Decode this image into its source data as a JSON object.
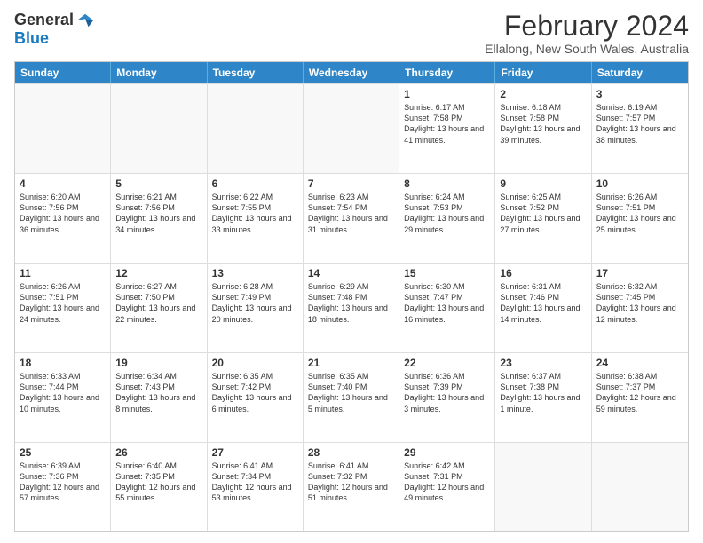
{
  "logo": {
    "general": "General",
    "blue": "Blue"
  },
  "title": "February 2024",
  "subtitle": "Ellalong, New South Wales, Australia",
  "header_days": [
    "Sunday",
    "Monday",
    "Tuesday",
    "Wednesday",
    "Thursday",
    "Friday",
    "Saturday"
  ],
  "weeks": [
    [
      {
        "day": "",
        "text": ""
      },
      {
        "day": "",
        "text": ""
      },
      {
        "day": "",
        "text": ""
      },
      {
        "day": "",
        "text": ""
      },
      {
        "day": "1",
        "text": "Sunrise: 6:17 AM\nSunset: 7:58 PM\nDaylight: 13 hours and 41 minutes."
      },
      {
        "day": "2",
        "text": "Sunrise: 6:18 AM\nSunset: 7:58 PM\nDaylight: 13 hours and 39 minutes."
      },
      {
        "day": "3",
        "text": "Sunrise: 6:19 AM\nSunset: 7:57 PM\nDaylight: 13 hours and 38 minutes."
      }
    ],
    [
      {
        "day": "4",
        "text": "Sunrise: 6:20 AM\nSunset: 7:56 PM\nDaylight: 13 hours and 36 minutes."
      },
      {
        "day": "5",
        "text": "Sunrise: 6:21 AM\nSunset: 7:56 PM\nDaylight: 13 hours and 34 minutes."
      },
      {
        "day": "6",
        "text": "Sunrise: 6:22 AM\nSunset: 7:55 PM\nDaylight: 13 hours and 33 minutes."
      },
      {
        "day": "7",
        "text": "Sunrise: 6:23 AM\nSunset: 7:54 PM\nDaylight: 13 hours and 31 minutes."
      },
      {
        "day": "8",
        "text": "Sunrise: 6:24 AM\nSunset: 7:53 PM\nDaylight: 13 hours and 29 minutes."
      },
      {
        "day": "9",
        "text": "Sunrise: 6:25 AM\nSunset: 7:52 PM\nDaylight: 13 hours and 27 minutes."
      },
      {
        "day": "10",
        "text": "Sunrise: 6:26 AM\nSunset: 7:51 PM\nDaylight: 13 hours and 25 minutes."
      }
    ],
    [
      {
        "day": "11",
        "text": "Sunrise: 6:26 AM\nSunset: 7:51 PM\nDaylight: 13 hours and 24 minutes."
      },
      {
        "day": "12",
        "text": "Sunrise: 6:27 AM\nSunset: 7:50 PM\nDaylight: 13 hours and 22 minutes."
      },
      {
        "day": "13",
        "text": "Sunrise: 6:28 AM\nSunset: 7:49 PM\nDaylight: 13 hours and 20 minutes."
      },
      {
        "day": "14",
        "text": "Sunrise: 6:29 AM\nSunset: 7:48 PM\nDaylight: 13 hours and 18 minutes."
      },
      {
        "day": "15",
        "text": "Sunrise: 6:30 AM\nSunset: 7:47 PM\nDaylight: 13 hours and 16 minutes."
      },
      {
        "day": "16",
        "text": "Sunrise: 6:31 AM\nSunset: 7:46 PM\nDaylight: 13 hours and 14 minutes."
      },
      {
        "day": "17",
        "text": "Sunrise: 6:32 AM\nSunset: 7:45 PM\nDaylight: 13 hours and 12 minutes."
      }
    ],
    [
      {
        "day": "18",
        "text": "Sunrise: 6:33 AM\nSunset: 7:44 PM\nDaylight: 13 hours and 10 minutes."
      },
      {
        "day": "19",
        "text": "Sunrise: 6:34 AM\nSunset: 7:43 PM\nDaylight: 13 hours and 8 minutes."
      },
      {
        "day": "20",
        "text": "Sunrise: 6:35 AM\nSunset: 7:42 PM\nDaylight: 13 hours and 6 minutes."
      },
      {
        "day": "21",
        "text": "Sunrise: 6:35 AM\nSunset: 7:40 PM\nDaylight: 13 hours and 5 minutes."
      },
      {
        "day": "22",
        "text": "Sunrise: 6:36 AM\nSunset: 7:39 PM\nDaylight: 13 hours and 3 minutes."
      },
      {
        "day": "23",
        "text": "Sunrise: 6:37 AM\nSunset: 7:38 PM\nDaylight: 13 hours and 1 minute."
      },
      {
        "day": "24",
        "text": "Sunrise: 6:38 AM\nSunset: 7:37 PM\nDaylight: 12 hours and 59 minutes."
      }
    ],
    [
      {
        "day": "25",
        "text": "Sunrise: 6:39 AM\nSunset: 7:36 PM\nDaylight: 12 hours and 57 minutes."
      },
      {
        "day": "26",
        "text": "Sunrise: 6:40 AM\nSunset: 7:35 PM\nDaylight: 12 hours and 55 minutes."
      },
      {
        "day": "27",
        "text": "Sunrise: 6:41 AM\nSunset: 7:34 PM\nDaylight: 12 hours and 53 minutes."
      },
      {
        "day": "28",
        "text": "Sunrise: 6:41 AM\nSunset: 7:32 PM\nDaylight: 12 hours and 51 minutes."
      },
      {
        "day": "29",
        "text": "Sunrise: 6:42 AM\nSunset: 7:31 PM\nDaylight: 12 hours and 49 minutes."
      },
      {
        "day": "",
        "text": ""
      },
      {
        "day": "",
        "text": ""
      }
    ]
  ]
}
